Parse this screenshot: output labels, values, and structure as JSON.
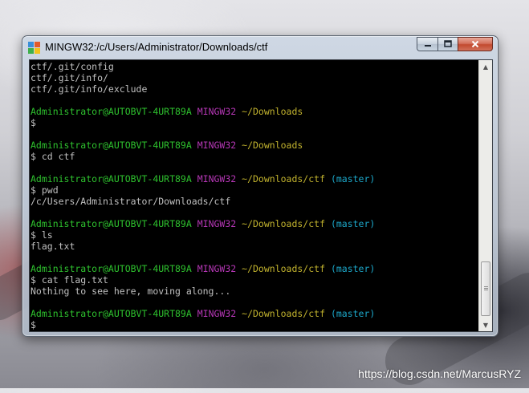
{
  "window": {
    "title": "MINGW32:/c/Users/Administrator/Downloads/ctf"
  },
  "caption_buttons": {
    "minimize_icon": "minimize-icon",
    "maximize_icon": "maximize-icon",
    "close_icon": "close-icon"
  },
  "terminal": {
    "colors": {
      "background": "#000000",
      "text": "#c0c0c0",
      "user_host": "#2ec22e",
      "msystem": "#b637b6",
      "path": "#c2b32e",
      "branch": "#1ca7c9"
    },
    "lines": [
      {
        "type": "output",
        "text": "ctf/.git/config"
      },
      {
        "type": "output",
        "text": "ctf/.git/info/"
      },
      {
        "type": "output",
        "text": "ctf/.git/info/exclude"
      },
      {
        "type": "blank",
        "text": ""
      },
      {
        "type": "prompt",
        "user": "Administrator@AUTOBVT-4URT89A",
        "system": "MINGW32",
        "path": "~/Downloads",
        "branch": ""
      },
      {
        "type": "command",
        "text": "$"
      },
      {
        "type": "blank",
        "text": ""
      },
      {
        "type": "prompt",
        "user": "Administrator@AUTOBVT-4URT89A",
        "system": "MINGW32",
        "path": "~/Downloads",
        "branch": ""
      },
      {
        "type": "command",
        "text": "$ cd ctf"
      },
      {
        "type": "blank",
        "text": ""
      },
      {
        "type": "prompt",
        "user": "Administrator@AUTOBVT-4URT89A",
        "system": "MINGW32",
        "path": "~/Downloads/ctf",
        "branch": "(master)"
      },
      {
        "type": "command",
        "text": "$ pwd"
      },
      {
        "type": "output",
        "text": "/c/Users/Administrator/Downloads/ctf"
      },
      {
        "type": "blank",
        "text": ""
      },
      {
        "type": "prompt",
        "user": "Administrator@AUTOBVT-4URT89A",
        "system": "MINGW32",
        "path": "~/Downloads/ctf",
        "branch": "(master)"
      },
      {
        "type": "command",
        "text": "$ ls"
      },
      {
        "type": "output",
        "text": "flag.txt"
      },
      {
        "type": "blank",
        "text": ""
      },
      {
        "type": "prompt",
        "user": "Administrator@AUTOBVT-4URT89A",
        "system": "MINGW32",
        "path": "~/Downloads/ctf",
        "branch": "(master)"
      },
      {
        "type": "command",
        "text": "$ cat flag.txt"
      },
      {
        "type": "output",
        "text": "Nothing to see here, moving along..."
      },
      {
        "type": "blank",
        "text": ""
      },
      {
        "type": "prompt",
        "user": "Administrator@AUTOBVT-4URT89A",
        "system": "MINGW32",
        "path": "~/Downloads/ctf",
        "branch": "(master)"
      },
      {
        "type": "command",
        "text": "$"
      }
    ]
  },
  "scrollbar": {
    "up_icon": "scroll-up-arrow-icon",
    "down_icon": "scroll-down-arrow-icon",
    "position": 1.0
  },
  "watermark": {
    "text": "https://blog.csdn.net/MarcusRYZ"
  }
}
